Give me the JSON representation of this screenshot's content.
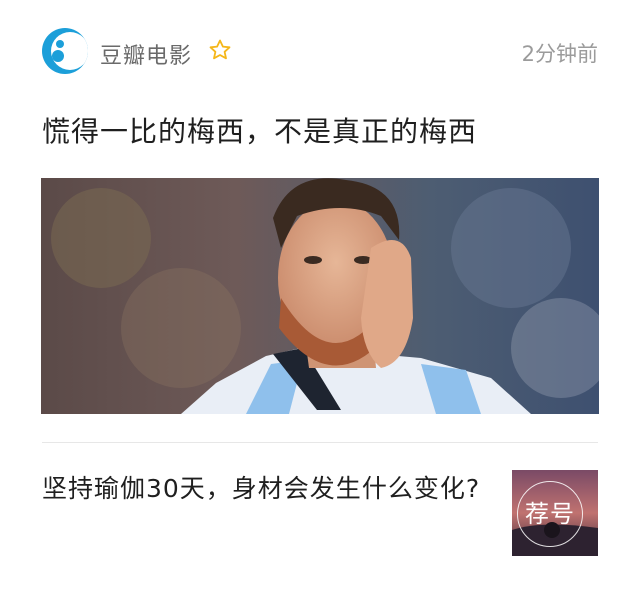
{
  "feed_card": {
    "source_name": "豆瓣电影",
    "timestamp": "2分钟前",
    "headline": "慌得一比的梅西，不是真正的梅西"
  },
  "related": {
    "title": "坚持瑜伽30天，身材会发生什么变化?",
    "thumb_stamp": "荐号"
  },
  "icons": {
    "source_logo": "douban-movie-logo",
    "follow": "star-outline-icon"
  },
  "colors": {
    "logo_blue": "#1c9fd9",
    "star_yellow": "#f5b71a",
    "muted_text": "#9b9b9b"
  }
}
